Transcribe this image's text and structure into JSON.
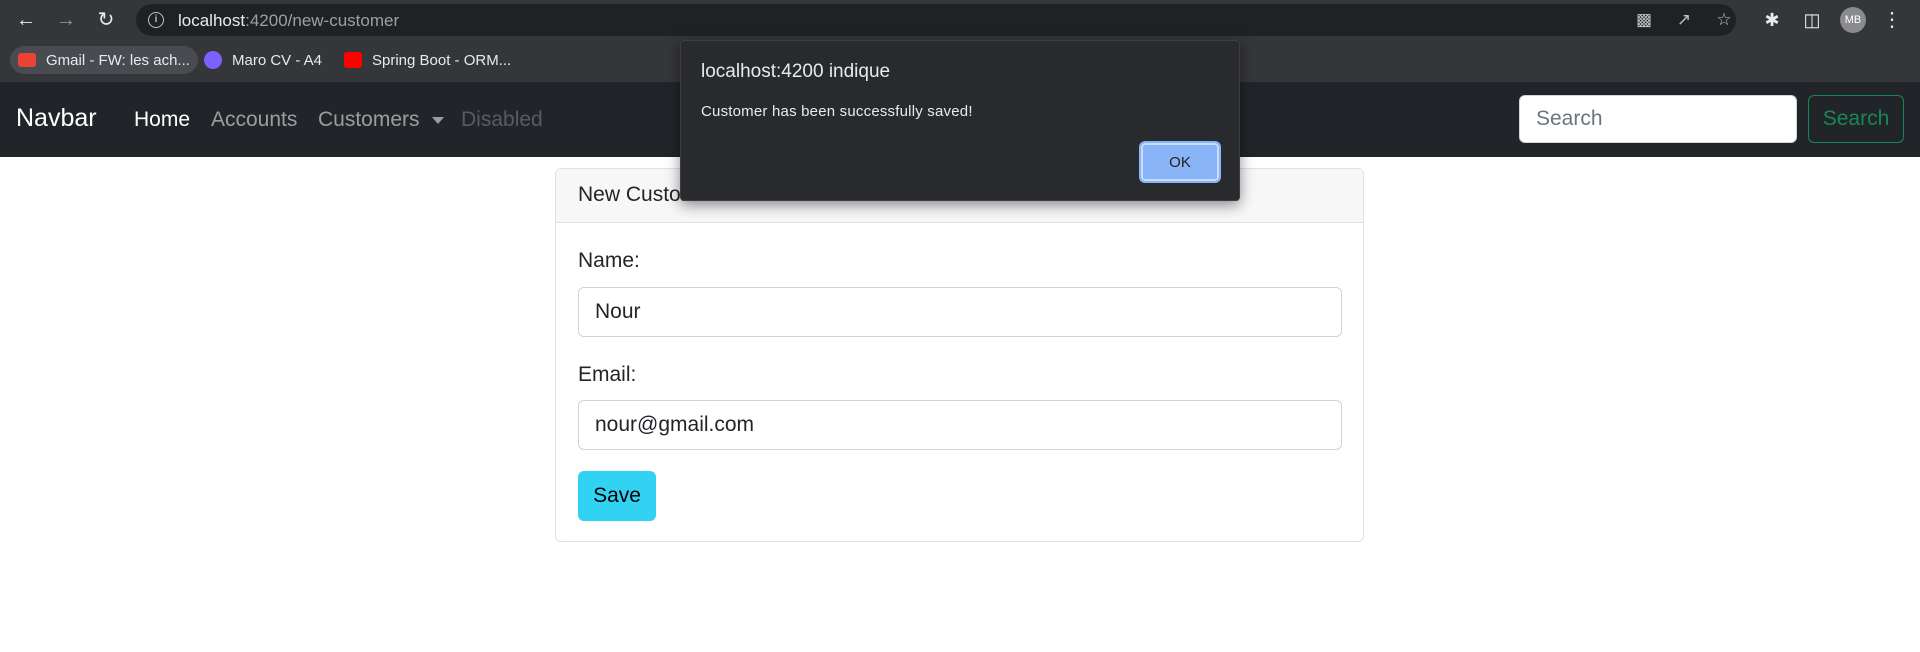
{
  "browser": {
    "url_host": "localhost",
    "url_path": ":4200/new-customer",
    "avatar_initials": "MB",
    "bookmarks": [
      {
        "label": "Gmail - FW: les ach..."
      },
      {
        "label": "Maro CV - A4"
      },
      {
        "label": "Spring Boot - ORM..."
      }
    ]
  },
  "navbar": {
    "brand": "Navbar",
    "links": {
      "home": "Home",
      "accounts": "Accounts",
      "customers": "Customers",
      "disabled": "Disabled"
    },
    "search_placeholder": "Search",
    "search_button": "Search"
  },
  "card": {
    "header": "New Customer",
    "name_label": "Name:",
    "name_value": "Nour",
    "email_label": "Email:",
    "email_value": "nour@gmail.com",
    "save_label": "Save"
  },
  "dialog": {
    "title": "localhost:4200 indique",
    "message": "Customer has been successfully saved!",
    "ok_label": "OK"
  },
  "colors": {
    "navbar_bg": "#212529",
    "save_button": "#31d2f2",
    "search_button": "#198754",
    "dialog_bg": "#292a2d",
    "ok_button": "#8ab4f8"
  }
}
